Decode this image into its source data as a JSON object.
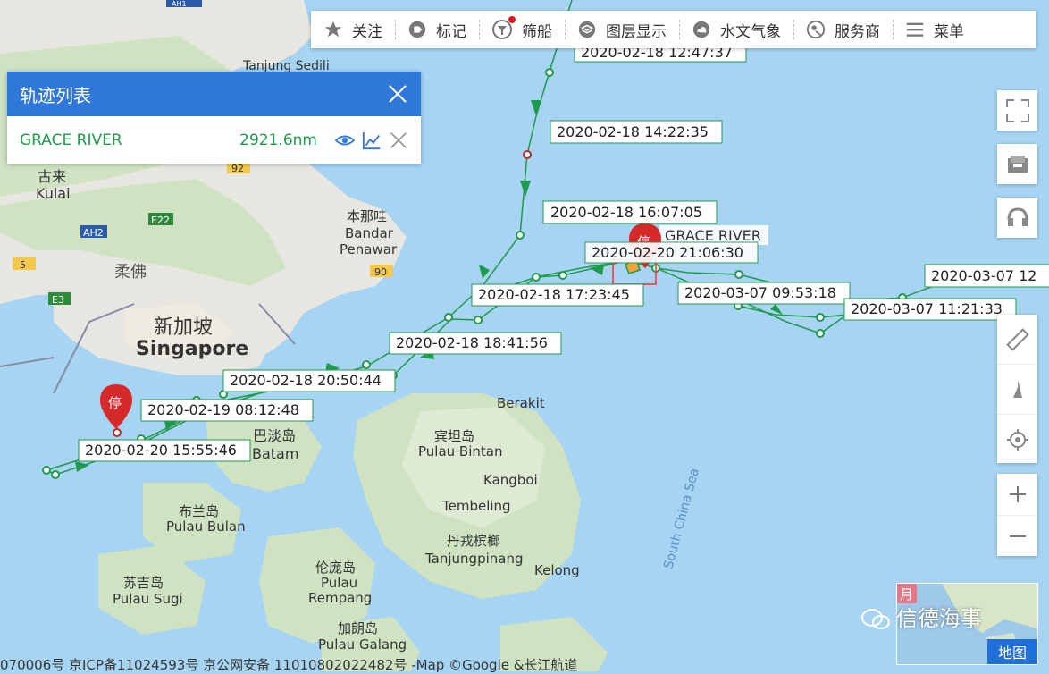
{
  "toolbar": {
    "items": [
      {
        "label": "关注",
        "icon": "star-icon"
      },
      {
        "label": "标记",
        "icon": "tag-icon"
      },
      {
        "label": "筛船",
        "icon": "filter-icon",
        "badge_color": "#e0161e"
      },
      {
        "label": "图层显示",
        "icon": "layers-icon"
      },
      {
        "label": "水文气象",
        "icon": "weather-icon"
      },
      {
        "label": "服务商",
        "icon": "service-icon"
      },
      {
        "label": "菜单",
        "icon": "menu-icon"
      }
    ]
  },
  "track_panel": {
    "title": "轨迹列表",
    "ship_name": "GRACE RIVER",
    "distance": "2921.6nm",
    "header_color": "#2f77d8",
    "track_color": "#1f9a4c"
  },
  "map": {
    "place_labels": {
      "kulai_cn": "古来",
      "kulai": "Kulai",
      "rou_fo": "柔佛",
      "singapore_cn": "新加坡",
      "singapore": "Singapore",
      "bandar_cn": "本那哇",
      "bandar": "Bandar",
      "penawar": "Penawar",
      "tanjung_sedili": "Tanjung Sedili",
      "batam_cn": "巴淡岛",
      "batam": "Batam",
      "berakit": "Berakit",
      "bintan_cn": "宾坦岛",
      "bintan": "Pulau Bintan",
      "kangboi": "Kangboi",
      "tembeling": "Tembeling",
      "tanjungpinang_cn": "丹戎槟榔",
      "tanjungpinang": "Tanjungpinang",
      "kelong": "Kelong",
      "bulan_cn": "布兰岛",
      "bulan": "Pulau Bulan",
      "sugi_cn": "苏吉岛",
      "sugi": "Pulau Sugi",
      "rempang_cn": "伦庞岛",
      "rempang_a": "Pulau",
      "rempang_b": "Rempang",
      "galang_cn": "加朗岛",
      "galang": "Pulau Galang",
      "south_china_sea": "South China Sea",
      "road_e22": "E22",
      "road_ah2": "AH2",
      "road_5": "5",
      "road_e3": "E3",
      "road_92": "92",
      "road_90": "90",
      "road_ah_top": "AH1"
    },
    "timestamps": [
      "2020-02-18 12:47:37",
      "2020-02-18 14:22:35",
      "2020-02-18 16:07:05",
      "2020-02-20 21:06:30",
      "2020-02-18 17:23:45",
      "2020-03-07 09:53:18",
      "2020-03-07 12",
      "2020-03-07 11:21:33",
      "2020-02-18 18:41:56",
      "2020-02-18 20:50:44",
      "2020-02-19 08:12:48",
      "2020-02-20 15:55:46"
    ],
    "ship_label": "GRACE RIVER",
    "stop_marker": "停"
  },
  "footer": {
    "text": "070006号  京ICP备11024593号  京公网安备 11010802022482号  -Map ©Google &长江航道"
  },
  "minimap": {
    "label": "地图",
    "watermark": "信德海事",
    "month_tag": "月"
  }
}
